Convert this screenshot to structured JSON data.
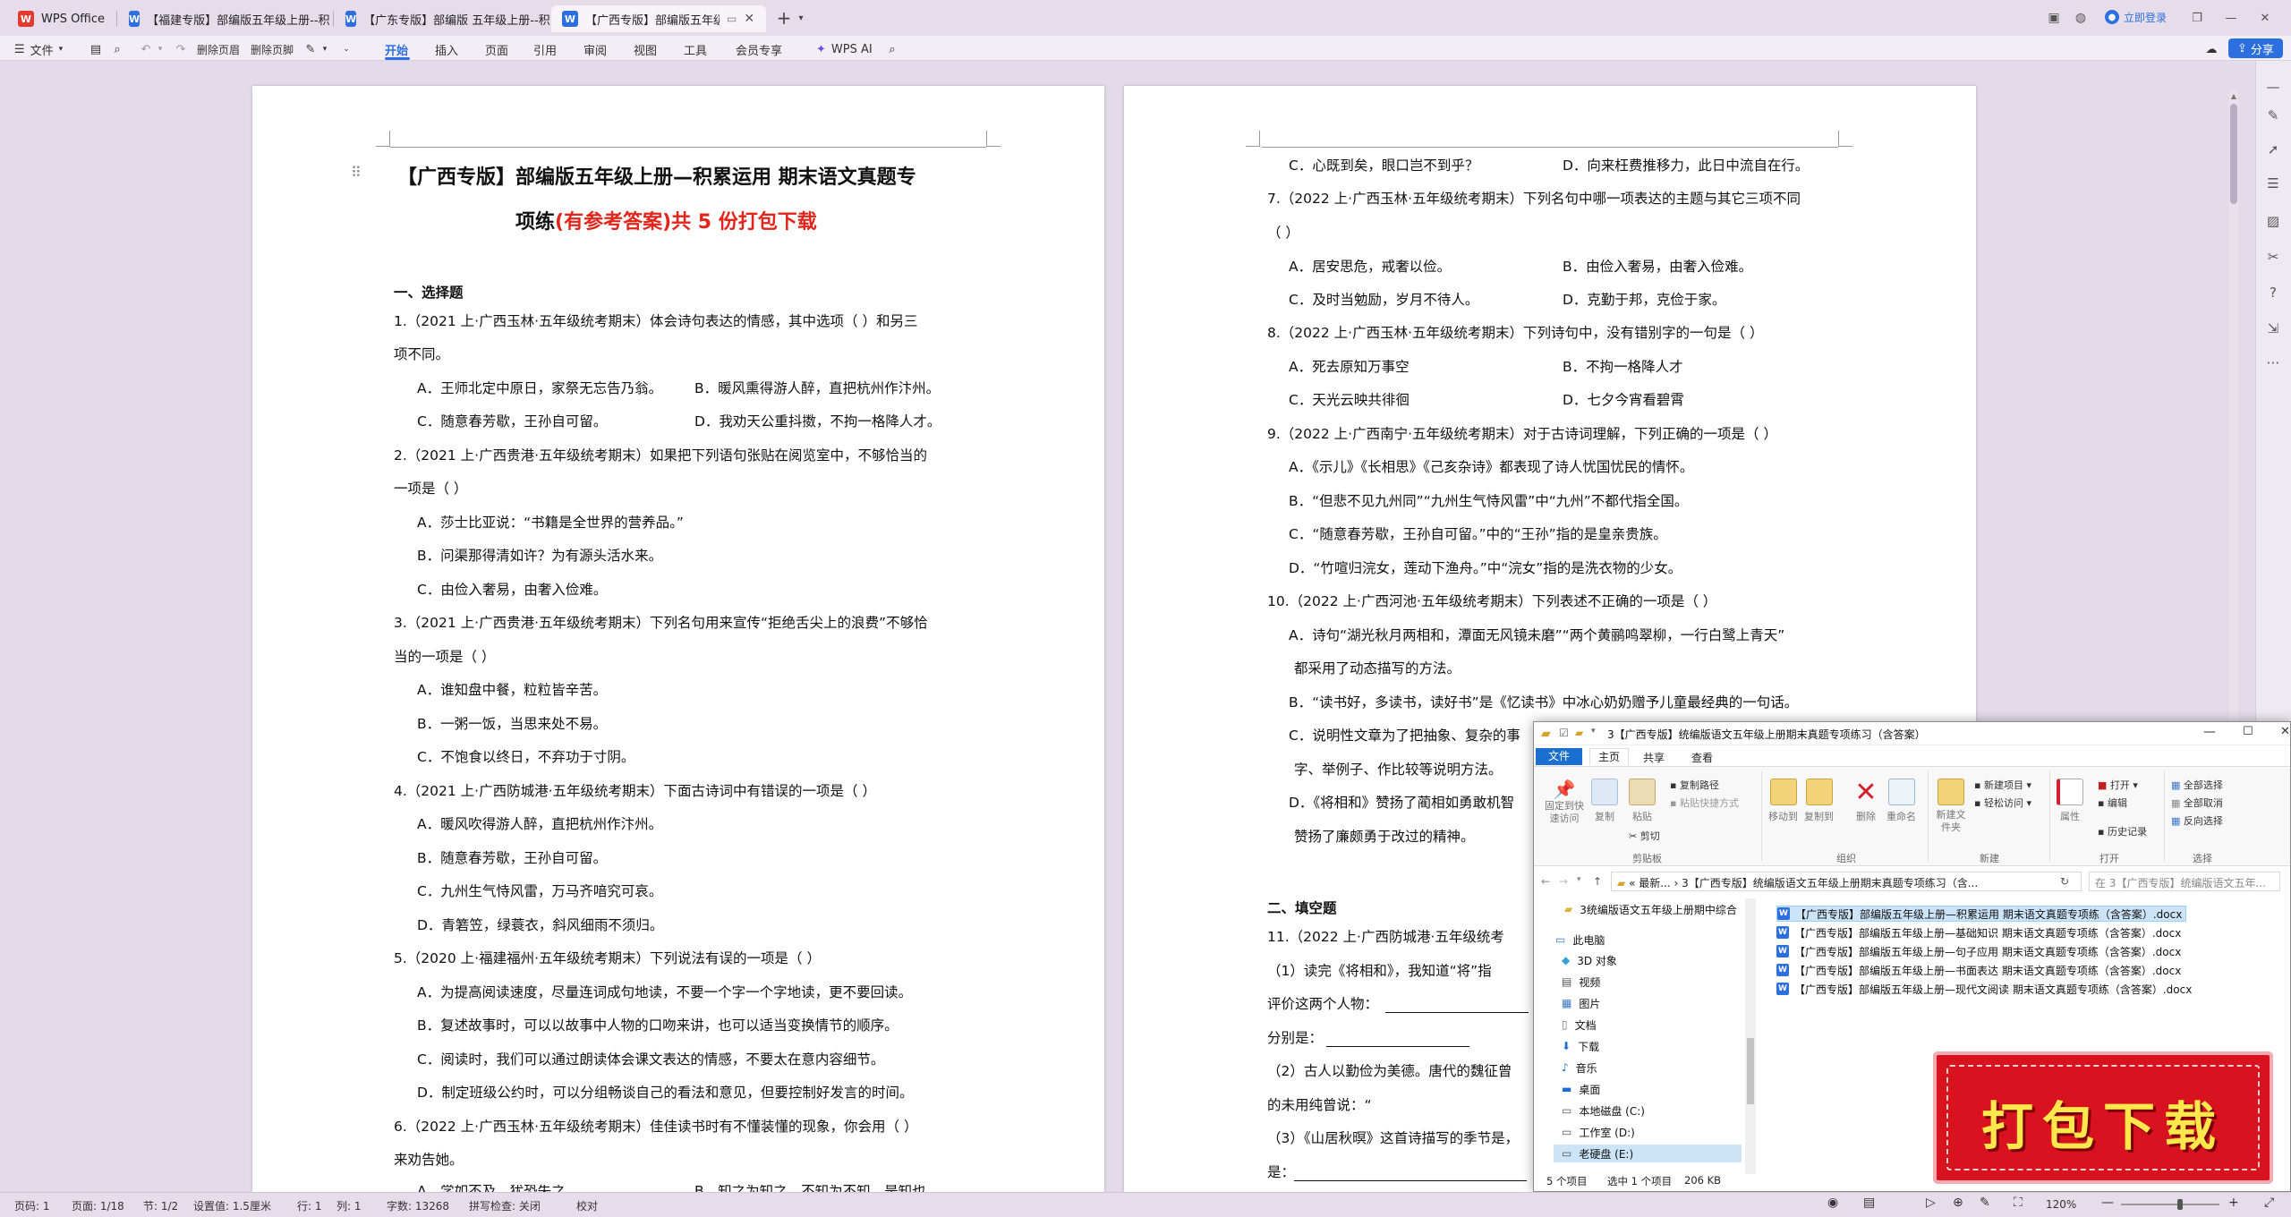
{
  "titlebar": {
    "app_name": "WPS Office",
    "tabs": [
      {
        "label": "【福建专版】部编版五年级上册--积"
      },
      {
        "label": "【广东专版】部编版 五年级上册--积"
      },
      {
        "label": "【广西专版】部编版五年级上"
      }
    ],
    "login": "立即登录"
  },
  "ribbon": {
    "file": "文件",
    "delete_header": "删除页眉",
    "delete_footer": "删除页脚",
    "tabs": [
      "开始",
      "插入",
      "页面",
      "引用",
      "审阅",
      "视图",
      "工具",
      "会员专享"
    ],
    "wps_ai": "WPS AI",
    "share": "分享"
  },
  "page1": {
    "title_line1": "【广西专版】部编版五年级上册—积累运用  期末语文真题专",
    "title_line2_black": "项练",
    "title_line2_red": "(有参考答案)",
    "title_line2_tail": "共 5 份打包下载",
    "section1": "一、选择题",
    "lines": [
      "1.（2021 上·广西玉林·五年级统考期末）体会诗句表达的情感，其中选项（    ）和另三",
      "项不同。",
      "2.（2021 上·广西贵港·五年级统考期末）如果把下列语句张贴在阅览室中，不够恰当的",
      "一项是（    ）",
      "A．莎士比亚说：“书籍是全世界的营养品。”",
      "B．问渠那得清如许？为有源头活水来。",
      "C．由俭入奢易，由奢入俭难。",
      "3.（2021 上·广西贵港·五年级统考期末）下列名句用来宣传“拒绝舌尖上的浪费”不够恰",
      "当的一项是（    ）",
      "A．谁知盘中餐，粒粒皆辛苦。",
      "B．一粥一饭，当思来处不易。",
      "C．不饱食以终日，不弃功于寸阴。",
      "4.（2021 上·广西防城港·五年级统考期末）下面古诗词中有错误的一项是（    ）",
      "A．暖风吹得游人醉，直把杭州作汴州。",
      "B．随意春芳歇，王孙自可留。",
      "C．九州生气恃风雷，万马齐喑究可哀。",
      "D．青箬笠，绿蓑衣，斜风细雨不须归。",
      "5.（2020 上·福建福州·五年级统考期末）下列说法有误的一项是（    ）",
      "A．为提高阅读速度，尽量连词成句地读，不要一个字一个字地读，更不要回读。",
      "B．复述故事时，可以以故事中人物的口吻来讲，也可以适当变换情节的顺序。",
      "C．阅读时，我们可以通过朗读体会课文表达的情感，不要太在意内容细节。",
      "D．制定班级公约时，可以分组畅谈自己的看法和意见，但要控制好发言的时间。",
      "6.（2022 上·广西玉林·五年级统考期末）佳佳读书时有不懂装懂的现象，你会用（    ）",
      "来劝告她。"
    ],
    "q1_options": [
      "A．王师北定中原日，家祭无忘告乃翁。",
      "B．暖风熏得游人醉，直把杭州作汴州。",
      "C．随意春芳歇，王孙自可留。",
      "D．我劝天公重抖擞，不拘一格降人才。"
    ],
    "q6_partial": [
      "A．学如不及，犹恐失之",
      "B．知之为知之，不知为不知，是知也"
    ]
  },
  "page2": {
    "lines_top": [
      "C．心既到矣，眼口岂不到乎？",
      "D．向来枉费推移力，此日中流自在行。",
      "7.（2022 上·广西玉林·五年级统考期末）下列名句中哪一项表达的主题与其它三项不同",
      "（    ）",
      "A．居安思危，戒奢以俭。",
      "B．由俭入奢易，由奢入俭难。",
      "C．及时当勉励，岁月不待人。",
      "D．克勤于邦，克俭于家。",
      "8.（2022 上·广西玉林·五年级统考期末）下列诗句中，没有错别字的一句是（    ）",
      "A．死去原知万事空",
      "B．不拘一格降人才",
      "C．天光云映共徘徊",
      "D．七夕今宵看碧霄",
      "9.（2022 上·广西南宁·五年级统考期末）对于古诗词理解，下列正确的一项是（    ）",
      "A．《示儿》《长相思》《己亥杂诗》都表现了诗人忧国忧民的情怀。",
      "B．“但悲不见九州同”“九州生气恃风雷”中“九州”不都代指全国。",
      "C．“随意春芳歇，王孙自可留。”中的“王孙”指的是皇亲贵族。",
      "D．“竹喧归浣女，莲动下渔舟。”中“浣女”指的是洗衣物的少女。",
      "10.（2022 上·广西河池·五年级统考期末）下列表述不正确的一项是（    ）",
      "A．诗句“湖光秋月两相和，潭面无风镜未磨”“两个黄鹂鸣翠柳，一行白鹭上青天”",
      "都采用了动态描写的方法。",
      "B．“读书好，多读书，读好书”是《忆读书》中冰心奶奶赠予儿童最经典的一句话。",
      "C．说明性文章为了把抽象、复杂的事",
      "字、举例子、作比较等说明方法。",
      "D．《将相和》赞扬了蔺相如勇敢机智",
      "赞扬了廉颇勇于改过的精神。",
      "二、填空题",
      "11.（2022 上·广西防城港·五年级统考",
      "（1）读完《将相和》，我知道“将”指",
      "评价这两个人物：",
      "分别是：",
      "（2）古人以勤俭为美德。唐代的魏征曾",
      "的未用纯曾说：“",
      "（3）《山居秋暝》这首诗描写的季节是，",
      "是："
    ]
  },
  "explorer": {
    "title": "3【广西专版】统编版语文五年级上册期末真题专项练习（含答案）",
    "menu": [
      "文件",
      "主页",
      "共享",
      "查看"
    ],
    "clipboard": {
      "pin": "固定到快速访问",
      "copy": "复制",
      "paste": "粘贴",
      "copy_path": "复制路径",
      "paste_shortcut": "粘贴快捷方式",
      "cut": "剪切",
      "group": "剪贴板"
    },
    "organize": {
      "move": "移动到",
      "copyto": "复制到",
      "delete": "删除",
      "rename": "重命名",
      "group": "组织"
    },
    "new": {
      "folder": "新建文件夹",
      "new_item": "新建项目",
      "easy_access": "轻松访问",
      "group": "新建"
    },
    "open": {
      "props": "属性",
      "open": "打开",
      "edit": "编辑",
      "history": "历史记录",
      "group": "打开"
    },
    "select": {
      "all": "全部选择",
      "none": "全部取消",
      "invert": "反向选择",
      "group": "选择"
    },
    "address": "« 最新... › 3【广西专版】统编版语文五年级上册期末真题专项练习（含...",
    "search_placeholder": "在 3【广西专版】统编版语文五年...",
    "nav": [
      {
        "label": "3统编版语文五年级上册期中综合"
      },
      {
        "label": "此电脑"
      },
      {
        "label": "3D 对象"
      },
      {
        "label": "视频"
      },
      {
        "label": "图片"
      },
      {
        "label": "文档"
      },
      {
        "label": "下载"
      },
      {
        "label": "音乐"
      },
      {
        "label": "桌面"
      },
      {
        "label": "本地磁盘 (C:)"
      },
      {
        "label": "工作室 (D:)"
      },
      {
        "label": "老硬盘 (E:)"
      }
    ],
    "files": [
      "【广西专版】部编版五年级上册—积累运用 期末语文真题专项练（含答案）.docx",
      "【广西专版】部编版五年级上册—基础知识  期末语文真题专项练（含答案）.docx",
      "【广西专版】部编版五年级上册—句子应用  期末语文真题专项练（含答案）.docx",
      "【广西专版】部编版五年级上册—书面表达  期末语文真题专项练（含答案）.docx",
      "【广西专版】部编版五年级上册—现代文阅读 期末语文真题专项练（含答案）.docx"
    ],
    "status": {
      "count": "5 个项目",
      "selected": "选中 1 个项目",
      "size": "206 KB"
    }
  },
  "stamp": {
    "text": "打包下载"
  },
  "statusbar": {
    "page_num": "页码: 1",
    "pages": "页面: 1/18",
    "section": "节: 1/2",
    "settings": "设置值: 1.5厘米",
    "row": "行: 1",
    "col": "列: 1",
    "words": "字数: 13268",
    "spell": "拼写检查: 关闭",
    "proof": "校对",
    "zoom": "120%"
  }
}
